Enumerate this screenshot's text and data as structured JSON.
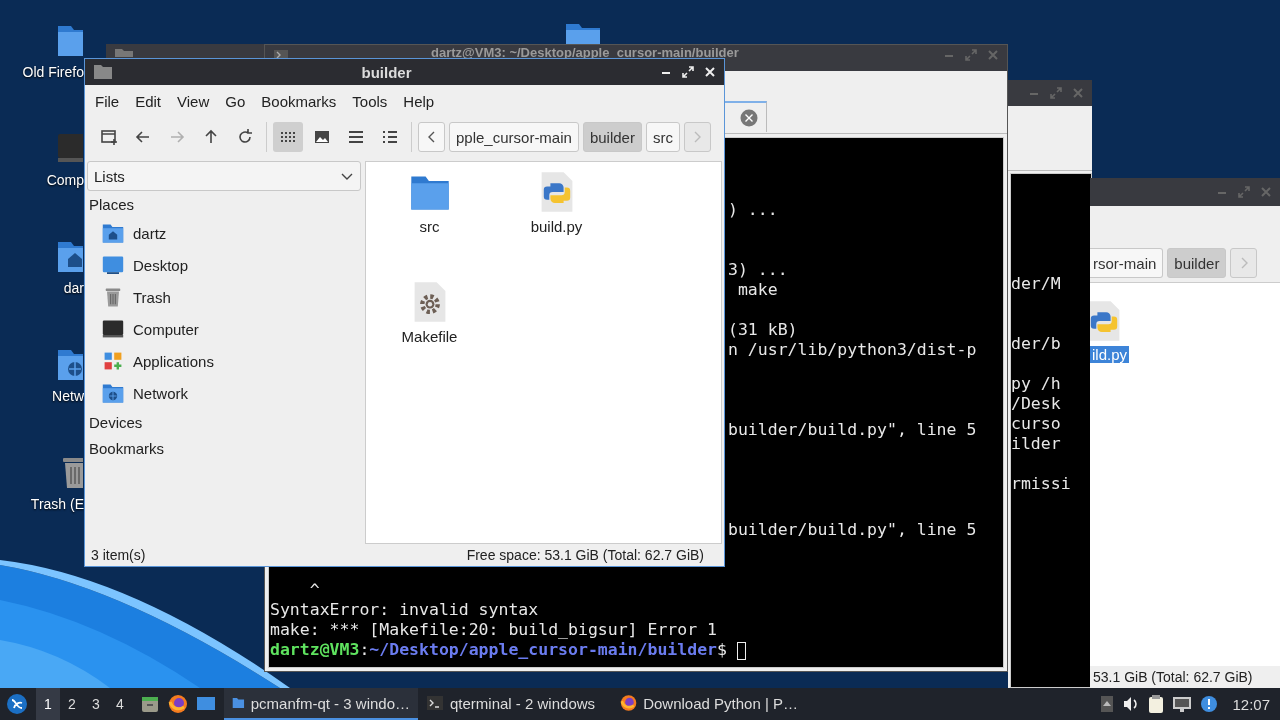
{
  "desktop": {
    "icons": [
      {
        "label": "Old Firefo",
        "kind": "folder"
      },
      {
        "label": "Comp",
        "kind": "computer"
      },
      {
        "label": "dar",
        "kind": "home"
      },
      {
        "label": "Netw",
        "kind": "network"
      },
      {
        "label": "Trash (E",
        "kind": "trash"
      }
    ]
  },
  "terminal": {
    "title": "dartz@VM3: ~/Desktop/apple_cursor-main/builder",
    "right_lines": [
      {
        "kind": "blank"
      },
      {
        "kind": "blank"
      },
      {
        "kind": "blank"
      },
      {
        "kind": "text",
        "text": ") ..."
      },
      {
        "kind": "blank"
      },
      {
        "kind": "blank"
      },
      {
        "kind": "text",
        "text": "3) ..."
      },
      {
        "kind": "text",
        "text": " make"
      },
      {
        "kind": "blank"
      },
      {
        "kind": "text",
        "text": "(31 kB)"
      },
      {
        "kind": "text",
        "text": "n /usr/lib/python3/dist-p"
      },
      {
        "kind": "blank"
      },
      {
        "kind": "blank"
      },
      {
        "kind": "blank"
      },
      {
        "kind": "text",
        "text": "builder/build.py\", line 5"
      },
      {
        "kind": "blank"
      },
      {
        "kind": "blank"
      },
      {
        "kind": "blank"
      },
      {
        "kind": "blank"
      },
      {
        "kind": "text",
        "text": "builder/build.py\", line 5"
      }
    ],
    "bottom_lines": [
      "    ^",
      "SyntaxError: invalid syntax",
      "make: *** [Makefile:20: build_bigsur] Error 1"
    ],
    "prompt": {
      "user_host": "dartz@VM3",
      "separator": ":",
      "path": "~/Desktop/apple_cursor-main/builder",
      "symbol": "$"
    }
  },
  "terminal_2": {
    "lines": [
      {
        "kind": "text",
        "text": "der/M"
      },
      {
        "kind": "blank"
      },
      {
        "kind": "blank"
      },
      {
        "kind": "text",
        "text": "der/b"
      },
      {
        "kind": "blank"
      },
      {
        "kind": "text",
        "text": "py /h"
      },
      {
        "kind": "text",
        "text": "/Desk"
      },
      {
        "kind": "text",
        "text": "curso"
      },
      {
        "kind": "text",
        "text": "ilder"
      },
      {
        "kind": "blank"
      },
      {
        "kind": "text",
        "text": "rmissi"
      }
    ]
  },
  "file_manager": {
    "title": "builder",
    "menu": [
      "File",
      "Edit",
      "View",
      "Go",
      "Bookmarks",
      "Tools",
      "Help"
    ],
    "toolbar": {
      "nav": [
        {
          "kind": "new-tab",
          "disabled": false
        },
        {
          "kind": "back",
          "disabled": false
        },
        {
          "kind": "forward",
          "disabled": true
        },
        {
          "kind": "up",
          "disabled": false
        },
        {
          "kind": "reload",
          "disabled": false
        }
      ],
      "views": [
        {
          "kind": "icons",
          "selected": true
        },
        {
          "kind": "thumbnails",
          "selected": false
        },
        {
          "kind": "compact",
          "selected": false
        },
        {
          "kind": "details",
          "selected": false
        }
      ]
    },
    "path": {
      "buttons": [
        {
          "label": "pple_cursor-main",
          "selected": false
        },
        {
          "label": "builder",
          "selected": true
        },
        {
          "label": "src",
          "selected": false
        }
      ],
      "next_disabled": true
    },
    "sidebar": {
      "dropdown": "Lists",
      "sections": [
        {
          "title": "Places",
          "items": [
            {
              "label": "dartz",
              "kind": "home"
            },
            {
              "label": "Desktop",
              "kind": "desktop"
            },
            {
              "label": "Trash",
              "kind": "trash"
            },
            {
              "label": "Computer",
              "kind": "computer"
            },
            {
              "label": "Applications",
              "kind": "applications"
            },
            {
              "label": "Network",
              "kind": "network"
            }
          ]
        },
        {
          "title": "Devices"
        },
        {
          "title": "Bookmarks"
        }
      ]
    },
    "files": [
      {
        "name": "src",
        "kind": "folder",
        "selected": false
      },
      {
        "name": "build.py",
        "kind": "python",
        "selected": false
      },
      {
        "name": "Makefile",
        "kind": "makefile",
        "selected": false
      }
    ],
    "status": {
      "count": "3 item(s)",
      "free_space": "Free space: 53.1 GiB (Total: 62.7 GiB)"
    }
  },
  "file_manager_2": {
    "path": {
      "buttons": [
        {
          "label": "rsor-main",
          "selected": false
        },
        {
          "label": "builder",
          "selected": true
        }
      ],
      "next_disabled": true
    },
    "files": [
      {
        "name": "ild.py",
        "kind": "python",
        "selected": true
      }
    ],
    "status": {
      "free_space": "53.1 GiB (Total: 62.7 GiB)"
    }
  },
  "taskbar": {
    "workspaces": [
      {
        "label": "1",
        "selected": true
      },
      {
        "label": "2",
        "selected": false
      },
      {
        "label": "3",
        "selected": false
      },
      {
        "label": "4",
        "selected": false
      }
    ],
    "launchers": [
      {
        "kind": "files"
      },
      {
        "kind": "firefox"
      },
      {
        "kind": "desktop"
      }
    ],
    "tasks": [
      {
        "label": "pcmanfm-qt - 3 windo…",
        "kind": "files",
        "selected": true
      },
      {
        "label": "qterminal - 2 windows",
        "kind": "terminal",
        "selected": false
      },
      {
        "label": "Download Python | P…",
        "kind": "firefox",
        "selected": false
      }
    ],
    "tray": [
      {
        "kind": "up"
      },
      {
        "kind": "volume"
      },
      {
        "kind": "clipboard"
      },
      {
        "kind": "network"
      },
      {
        "kind": "notification"
      }
    ],
    "clock": "12:07"
  }
}
